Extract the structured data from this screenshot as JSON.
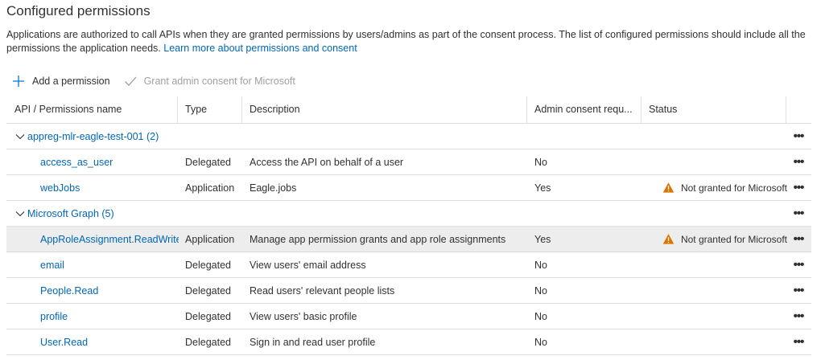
{
  "header": {
    "title": "Configured permissions",
    "description": "Applications are authorized to call APIs when they are granted permissions by users/admins as part of the consent process. The list of configured permissions should include all the permissions the application needs.",
    "learn_more": "Learn more about permissions and consent"
  },
  "toolbar": {
    "add_label": "Add a permission",
    "grant_label": "Grant admin consent for Microsoft"
  },
  "table": {
    "columns": {
      "name": "API / Permissions name",
      "type": "Type",
      "description": "Description",
      "admin": "Admin consent requ...",
      "status": "Status"
    },
    "more": "•••",
    "groups": [
      {
        "label": "appreg-mlr-eagle-test-001 (2)",
        "rows": [
          {
            "name": "access_as_user",
            "type": "Delegated",
            "description": "Access the API on behalf of a user",
            "admin": "No",
            "status": ""
          },
          {
            "name": "webJobs",
            "type": "Application",
            "description": "Eagle.jobs",
            "admin": "Yes",
            "status": "Not granted for Microsoft"
          }
        ]
      },
      {
        "label": "Microsoft Graph (5)",
        "rows": [
          {
            "name": "AppRoleAssignment.ReadWrite.All",
            "type": "Application",
            "description": "Manage app permission grants and app role assignments",
            "admin": "Yes",
            "status": "Not granted for Microsoft"
          },
          {
            "name": "email",
            "type": "Delegated",
            "description": "View users' email address",
            "admin": "No",
            "status": ""
          },
          {
            "name": "People.Read",
            "type": "Delegated",
            "description": "Read users' relevant people lists",
            "admin": "No",
            "status": ""
          },
          {
            "name": "profile",
            "type": "Delegated",
            "description": "View users' basic profile",
            "admin": "No",
            "status": ""
          },
          {
            "name": "User.Read",
            "type": "Delegated",
            "description": "Sign in and read user profile",
            "admin": "No",
            "status": ""
          }
        ]
      }
    ]
  }
}
